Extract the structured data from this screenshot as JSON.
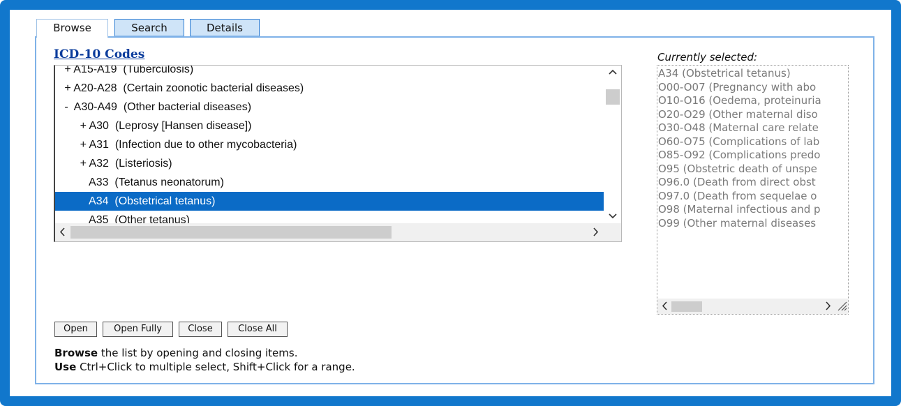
{
  "tabs": [
    {
      "label": "Browse",
      "active": true
    },
    {
      "label": "Search",
      "active": false
    },
    {
      "label": "Details",
      "active": false
    }
  ],
  "tree": {
    "heading": "ICD-10 Codes",
    "rows": [
      {
        "text": "   + A15-A19  (Tuberculosis)",
        "selected": false
      },
      {
        "text": "   + A20-A28  (Certain zoonotic bacterial diseases)",
        "selected": false
      },
      {
        "text": "   -  A30-A49  (Other bacterial diseases)",
        "selected": false
      },
      {
        "text": "        + A30  (Leprosy [Hansen disease])",
        "selected": false
      },
      {
        "text": "        + A31  (Infection due to other mycobacteria)",
        "selected": false
      },
      {
        "text": "        + A32  (Listeriosis)",
        "selected": false
      },
      {
        "text": "           A33  (Tetanus neonatorum)",
        "selected": false
      },
      {
        "text": "           A34  (Obstetrical tetanus)",
        "selected": true
      },
      {
        "text": "           A35  (Other tetanus)",
        "selected": false
      }
    ]
  },
  "selected_panel": {
    "label": "Currently selected:",
    "items": [
      "A34 (Obstetrical tetanus)",
      "O00-O07 (Pregnancy with abo",
      "O10-O16 (Oedema, proteinuria",
      "O20-O29 (Other maternal diso",
      "O30-O48 (Maternal care relate",
      "O60-O75 (Complications of lab",
      "O85-O92 (Complications predo",
      "O95 (Obstetric death of unspe",
      "O96.0 (Death from direct obst",
      "O97.0 (Death from sequelae o",
      "O98 (Maternal infectious and p",
      "O99 (Other maternal diseases"
    ]
  },
  "buttons": {
    "open": "Open",
    "open_fully": "Open Fully",
    "close": "Close",
    "close_all": "Close All"
  },
  "help": {
    "line1_bold": "Browse",
    "line1_rest": " the list by opening and closing items.",
    "line2_bold": "Use",
    "line2_rest": " Ctrl+Click to multiple select, Shift+Click for a range."
  },
  "icons": {
    "scroll_up": "chevron-up-icon",
    "scroll_down": "chevron-down-icon",
    "scroll_left": "chevron-left-icon",
    "scroll_right": "chevron-right-icon",
    "resize": "resize-grip-icon"
  },
  "colors": {
    "frame": "#1177cc",
    "selection": "#0b6bc6",
    "link": "#0b3c9c"
  }
}
